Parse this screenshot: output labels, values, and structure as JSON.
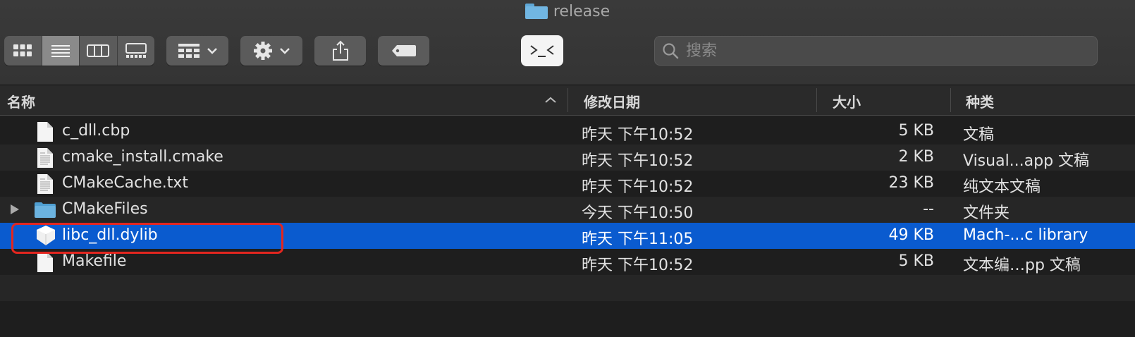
{
  "window": {
    "title": "release",
    "folder_icon": "folder-icon"
  },
  "toolbar": {
    "view_modes": [
      {
        "name": "icon-view",
        "icon": "grid-icon"
      },
      {
        "name": "list-view",
        "icon": "list-icon",
        "active": true
      },
      {
        "name": "column-view",
        "icon": "columns-icon"
      },
      {
        "name": "gallery-view",
        "icon": "gallery-icon"
      }
    ],
    "group_button_icon": "group-icon",
    "action_button_icon": "gear-icon",
    "share_button_icon": "share-icon",
    "tag_button_icon": "tag-icon",
    "terminal_button_icon": "terminal-icon"
  },
  "search": {
    "placeholder": "搜索",
    "value": ""
  },
  "columns": {
    "name": "名称",
    "date": "修改日期",
    "size": "大小",
    "kind": "种类"
  },
  "files": [
    {
      "name": "c_dll.cbp",
      "date": "昨天 下午10:52",
      "size": "5 KB",
      "kind": "文稿",
      "icon": "document-icon"
    },
    {
      "name": "cmake_install.cmake",
      "date": "昨天 下午10:52",
      "size": "2 KB",
      "kind": "Visual...app 文稿",
      "icon": "text-document-icon"
    },
    {
      "name": "CMakeCache.txt",
      "date": "昨天 下午10:52",
      "size": "23 KB",
      "kind": "纯文本文稿",
      "icon": "text-document-icon"
    },
    {
      "name": "CMakeFiles",
      "date": "今天 下午10:50",
      "size": "--",
      "kind": "文件夹",
      "icon": "folder-icon"
    },
    {
      "name": "libc_dll.dylib",
      "date": "昨天 下午11:05",
      "size": "49 KB",
      "kind": "Mach-...c library",
      "icon": "library-icon",
      "selected": true
    },
    {
      "name": "Makefile",
      "date": "昨天 下午10:52",
      "size": "5 KB",
      "kind": "文本编…pp 文稿",
      "icon": "document-icon"
    }
  ],
  "colors": {
    "selection": "#0a5bcf",
    "highlight_box": "#e3261f",
    "folder": "#71b6e2"
  }
}
